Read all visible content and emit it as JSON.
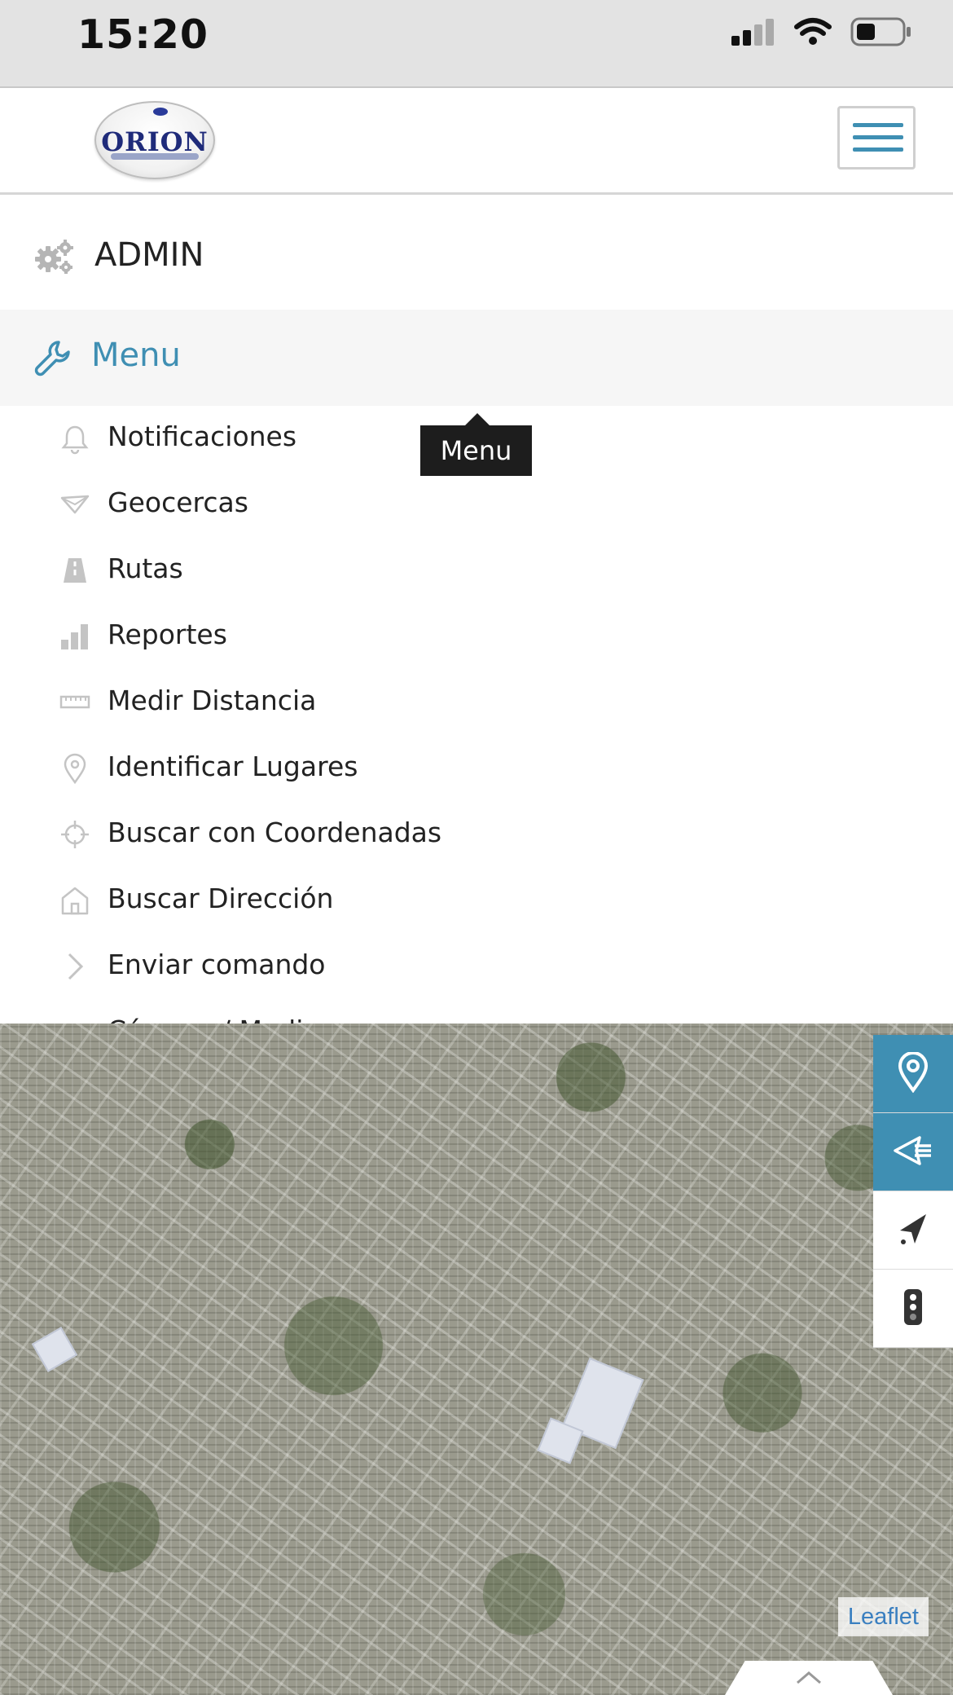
{
  "status_bar": {
    "time": "15:20",
    "icons": [
      "cellular-signal-icon",
      "wifi-icon",
      "battery-icon"
    ]
  },
  "header": {
    "logo_text": "ORION",
    "menu_toggle_icon": "hamburger-icon"
  },
  "admin": {
    "label": "ADMIN",
    "icon": "gears-icon"
  },
  "menu": {
    "label": "Menu",
    "icon": "wrench-icon",
    "tooltip": "Menu",
    "items": [
      {
        "label": "Notificaciones",
        "icon": "bell-icon"
      },
      {
        "label": "Geocercas",
        "icon": "geofence-icon"
      },
      {
        "label": "Rutas",
        "icon": "road-icon"
      },
      {
        "label": "Reportes",
        "icon": "bar-chart-icon"
      },
      {
        "label": "Medir Distancia",
        "icon": "ruler-icon"
      },
      {
        "label": "Identificar Lugares",
        "icon": "map-pin-icon"
      },
      {
        "label": "Buscar con Coordenadas",
        "icon": "crosshairs-icon"
      },
      {
        "label": "Buscar Dirección",
        "icon": "house-icon"
      },
      {
        "label": "Enviar comando",
        "icon": "chevron-right-icon"
      },
      {
        "label": "Cámara / Media",
        "icon": "camera-icon"
      }
    ]
  },
  "map": {
    "attribution": "Leaflet",
    "controls": [
      "location-pin-icon",
      "geofence-list-icon",
      "navigation-arrow-icon",
      "traffic-light-icon"
    ]
  },
  "colors": {
    "accent": "#3f8fb3",
    "tooltip_bg": "#1d1d1d",
    "menu_header_bg": "#f6f6f6"
  }
}
